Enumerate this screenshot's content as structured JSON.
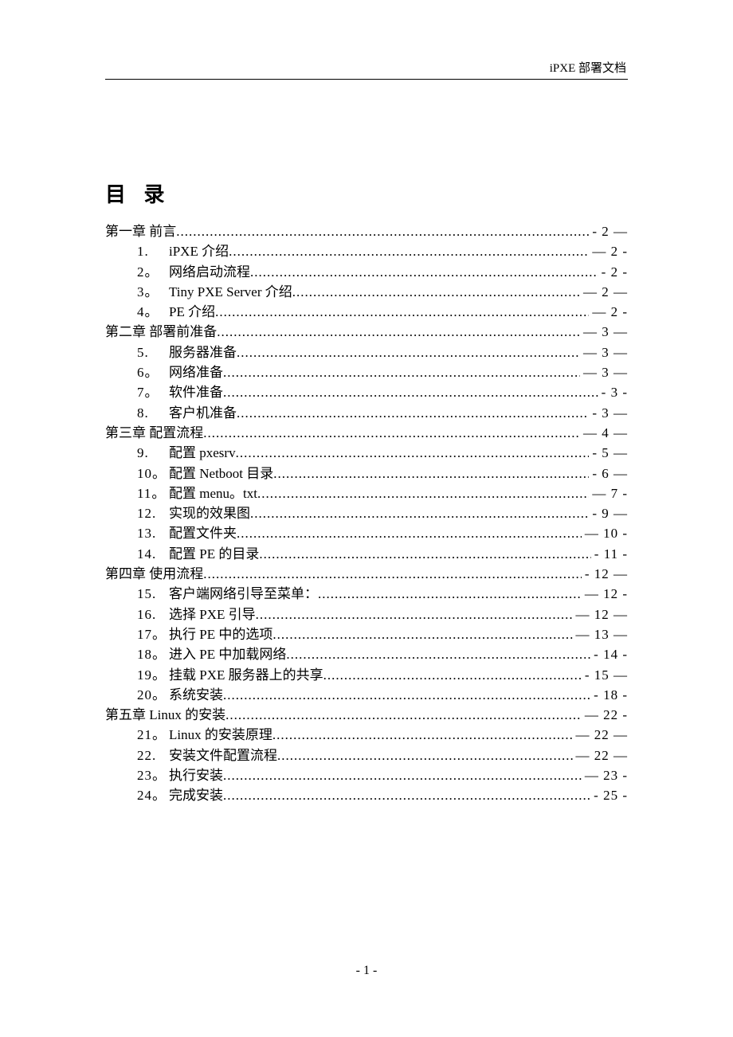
{
  "header": "iPXE 部署文档",
  "toc_title": "目  录",
  "footer": "- 1 -",
  "entries": [
    {
      "type": "chapter",
      "label": "第一章 前言",
      "page": "- 2 —"
    },
    {
      "type": "item",
      "num": "1.",
      "label": "iPXE 介绍",
      "page": "— 2 -"
    },
    {
      "type": "item",
      "num": "2。",
      "label": "网络启动流程",
      "page": "- 2 -"
    },
    {
      "type": "item",
      "num": "3。",
      "label": "Tiny PXE Server 介绍",
      "page": "— 2 —"
    },
    {
      "type": "item",
      "num": "4。",
      "label": "PE 介绍",
      "page": "— 2 -"
    },
    {
      "type": "chapter",
      "label": "第二章 部署前准备",
      "page": "— 3 —"
    },
    {
      "type": "item",
      "num": "5.",
      "label": "服务器准备",
      "page": "— 3 —"
    },
    {
      "type": "item",
      "num": "6。",
      "label": "网络准备",
      "page": "— 3 —"
    },
    {
      "type": "item",
      "num": "7。",
      "label": "软件准备",
      "page": "- 3 -"
    },
    {
      "type": "item",
      "num": "8.",
      "label": "客户机准备",
      "page": "- 3 —"
    },
    {
      "type": "chapter",
      "label": "第三章 配置流程",
      "page": "— 4 —"
    },
    {
      "type": "item",
      "num": "9.",
      "label": "配置 pxesrv",
      "page": "- 5 —"
    },
    {
      "type": "item",
      "num": "10。",
      "label": "配置 Netboot 目录",
      "page": "- 6 —"
    },
    {
      "type": "item",
      "num": "11。",
      "label": "配置 menu。txt",
      "page": "— 7 -"
    },
    {
      "type": "item",
      "num": "12.",
      "label": "实现的效果图",
      "page": "- 9 —"
    },
    {
      "type": "item",
      "num": "13.",
      "label": "配置文件夹",
      "page": "— 10 -"
    },
    {
      "type": "item",
      "num": "14.",
      "label": "配置 PE 的目录",
      "page": "- 11 -"
    },
    {
      "type": "chapter",
      "label": "第四章 使用流程",
      "page": "- 12 —"
    },
    {
      "type": "item",
      "num": "15.",
      "label": "客户端网络引导至菜单：",
      "page": "— 12 -"
    },
    {
      "type": "item",
      "num": "16.",
      "label": "选择 PXE 引导",
      "page": "— 12 —"
    },
    {
      "type": "item",
      "num": "17。",
      "label": "执行 PE 中的选项",
      "page": "— 13 —"
    },
    {
      "type": "item",
      "num": "18。",
      "label": "进入 PE 中加载网络",
      "page": "- 14 -"
    },
    {
      "type": "item",
      "num": "19。",
      "label": "挂载 PXE 服务器上的共享",
      "page": "- 15 —"
    },
    {
      "type": "item",
      "num": "20。",
      "label": "系统安装",
      "page": "- 18 -"
    },
    {
      "type": "chapter",
      "label": "第五章 Linux 的安装",
      "page": "— 22 -"
    },
    {
      "type": "item",
      "num": "21。",
      "label": "Linux 的安装原理",
      "page": "— 22 —"
    },
    {
      "type": "item",
      "num": "22.",
      "label": "安装文件配置流程",
      "page": "— 22 —"
    },
    {
      "type": "item",
      "num": "23。",
      "label": "执行安装",
      "page": "— 23 -"
    },
    {
      "type": "item",
      "num": "24。",
      "label": "完成安装",
      "page": "- 25 -"
    }
  ]
}
